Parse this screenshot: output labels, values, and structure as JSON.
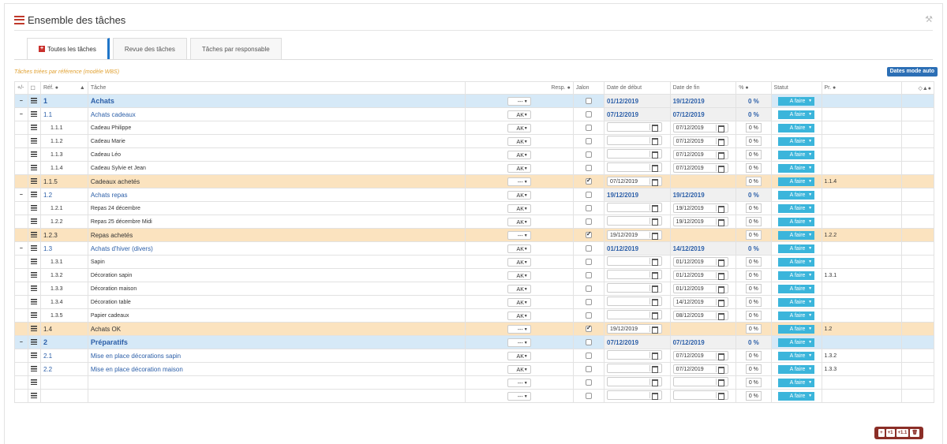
{
  "page": {
    "title": "Ensemble des tâches",
    "subtitle": "Tâches triées par référence (modèle WBS)",
    "auto_dates_button": "Dates mode auto"
  },
  "tabs": [
    {
      "label": "Toutes les tâches",
      "active": true
    },
    {
      "label": "Revue des tâches",
      "active": false
    },
    {
      "label": "Tâches par responsable",
      "active": false
    }
  ],
  "columns": {
    "toggle": "+/-",
    "ref": "Réf.",
    "task": "Tâche",
    "resp": "Resp.",
    "milestone": "Jalon",
    "start": "Date de début",
    "end": "Date de fin",
    "pct": "%",
    "status": "Statut",
    "pred": "Pr."
  },
  "rows": [
    {
      "type": "l1",
      "toggle": "−",
      "ref": "1",
      "task": "Achats",
      "resp": "---",
      "milestone": false,
      "start": "01/12/2019",
      "end": "19/12/2019",
      "pct": "0 %",
      "status": "A faire",
      "pred": ""
    },
    {
      "type": "l2",
      "toggle": "−",
      "ref": "1.1",
      "task": "Achats cadeaux",
      "resp": "AK",
      "milestone": false,
      "start": "07/12/2019",
      "end": "07/12/2019",
      "pct": "0 %",
      "status": "A faire",
      "pred": ""
    },
    {
      "type": "l3",
      "toggle": "",
      "ref": "1.1.1",
      "task": "Cadeau Philippe",
      "resp": "AK",
      "milestone": false,
      "start": "",
      "end": "07/12/2019",
      "pct": "0 %",
      "status": "A faire",
      "pred": ""
    },
    {
      "type": "l3",
      "toggle": "",
      "ref": "1.1.2",
      "task": "Cadeau Marie",
      "resp": "AK",
      "milestone": false,
      "start": "",
      "end": "07/12/2019",
      "pct": "0 %",
      "status": "A faire",
      "pred": ""
    },
    {
      "type": "l3",
      "toggle": "",
      "ref": "1.1.3",
      "task": "Cadeau Léo",
      "resp": "AK",
      "milestone": false,
      "start": "",
      "end": "07/12/2019",
      "pct": "0 %",
      "status": "A faire",
      "pred": ""
    },
    {
      "type": "l3",
      "toggle": "",
      "ref": "1.1.4",
      "task": "Cadeau Sylvie et Jean",
      "resp": "AK",
      "milestone": false,
      "start": "",
      "end": "07/12/2019",
      "pct": "0 %",
      "status": "A faire",
      "pred": ""
    },
    {
      "type": "milestone",
      "toggle": "",
      "ref": "1.1.5",
      "task": "Cadeaux achetés",
      "resp": "---",
      "milestone": true,
      "start": "07/12/2019",
      "end": "",
      "pct": "0 %",
      "status": "A faire",
      "pred": "1.1.4"
    },
    {
      "type": "l2",
      "toggle": "−",
      "ref": "1.2",
      "task": "Achats repas",
      "resp": "AK",
      "milestone": false,
      "start": "19/12/2019",
      "end": "19/12/2019",
      "pct": "0 %",
      "status": "A faire",
      "pred": ""
    },
    {
      "type": "l3",
      "toggle": "",
      "ref": "1.2.1",
      "task": "Repas 24 décembre",
      "resp": "AK",
      "milestone": false,
      "start": "",
      "end": "19/12/2019",
      "pct": "0 %",
      "status": "A faire",
      "pred": ""
    },
    {
      "type": "l3",
      "toggle": "",
      "ref": "1.2.2",
      "task": "Repas 25 décembre Midi",
      "resp": "AK",
      "milestone": false,
      "start": "",
      "end": "19/12/2019",
      "pct": "0 %",
      "status": "A faire",
      "pred": ""
    },
    {
      "type": "milestone",
      "toggle": "",
      "ref": "1.2.3",
      "task": "Repas achetés",
      "resp": "---",
      "milestone": true,
      "start": "19/12/2019",
      "end": "",
      "pct": "0 %",
      "status": "A faire",
      "pred": "1.2.2"
    },
    {
      "type": "l2",
      "toggle": "−",
      "ref": "1.3",
      "task": "Achats d'hiver (divers)",
      "resp": "AK",
      "milestone": false,
      "start": "01/12/2019",
      "end": "14/12/2019",
      "pct": "0 %",
      "status": "A faire",
      "pred": ""
    },
    {
      "type": "l3",
      "toggle": "",
      "ref": "1.3.1",
      "task": "Sapin",
      "resp": "AK",
      "milestone": false,
      "start": "",
      "end": "01/12/2019",
      "pct": "0 %",
      "status": "A faire",
      "pred": ""
    },
    {
      "type": "l3",
      "toggle": "",
      "ref": "1.3.2",
      "task": "Décoration sapin",
      "resp": "AK",
      "milestone": false,
      "start": "",
      "end": "01/12/2019",
      "pct": "0 %",
      "status": "A faire",
      "pred": "1.3.1"
    },
    {
      "type": "l3",
      "toggle": "",
      "ref": "1.3.3",
      "task": "Décoration maison",
      "resp": "AK",
      "milestone": false,
      "start": "",
      "end": "01/12/2019",
      "pct": "0 %",
      "status": "A faire",
      "pred": ""
    },
    {
      "type": "l3",
      "toggle": "",
      "ref": "1.3.4",
      "task": "Décoration table",
      "resp": "AK",
      "milestone": false,
      "start": "",
      "end": "14/12/2019",
      "pct": "0 %",
      "status": "A faire",
      "pred": ""
    },
    {
      "type": "l3",
      "toggle": "",
      "ref": "1.3.5",
      "task": "Papier cadeaux",
      "resp": "AK",
      "milestone": false,
      "start": "",
      "end": "08/12/2019",
      "pct": "0 %",
      "status": "A faire",
      "pred": ""
    },
    {
      "type": "milestone",
      "toggle": "",
      "ref": "1.4",
      "task": "Achats OK",
      "resp": "---",
      "milestone": true,
      "start": "19/12/2019",
      "end": "",
      "pct": "0 %",
      "status": "A faire",
      "pred": "1.2"
    },
    {
      "type": "l1",
      "toggle": "−",
      "ref": "2",
      "task": "Préparatifs",
      "resp": "---",
      "milestone": false,
      "start": "07/12/2019",
      "end": "07/12/2019",
      "pct": "0 %",
      "status": "A faire",
      "pred": ""
    },
    {
      "type": "l2leaf",
      "toggle": "",
      "ref": "2.1",
      "task": "Mise en place décorations sapin",
      "resp": "AK",
      "milestone": false,
      "start": "",
      "end": "07/12/2019",
      "pct": "0 %",
      "status": "A faire",
      "pred": "1.3.2"
    },
    {
      "type": "l2leaf",
      "toggle": "",
      "ref": "2.2",
      "task": "Mise en place décoration maison",
      "resp": "AK",
      "milestone": false,
      "start": "",
      "end": "07/12/2019",
      "pct": "0 %",
      "status": "A faire",
      "pred": "1.3.3"
    },
    {
      "type": "empty",
      "toggle": "",
      "ref": "",
      "task": "",
      "resp": "---",
      "milestone": false,
      "start": "",
      "end": "",
      "pct": "0 %",
      "status": "A faire",
      "pred": ""
    },
    {
      "type": "empty",
      "toggle": "",
      "ref": "",
      "task": "",
      "resp": "---",
      "milestone": false,
      "start": "",
      "end": "",
      "pct": "0 %",
      "status": "A faire",
      "pred": ""
    }
  ],
  "actions": [
    "+",
    "+1",
    "+1.1",
    "🗑"
  ]
}
